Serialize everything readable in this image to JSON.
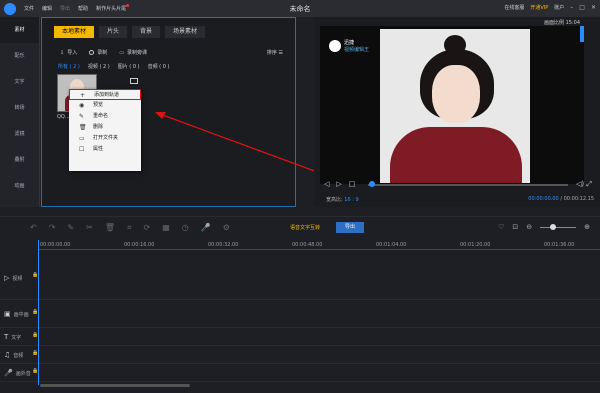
{
  "titlebar": {
    "menu": [
      "文件",
      "编辑",
      "导出",
      "帮助",
      "制作片头片尾"
    ],
    "title": "未命名",
    "online_service": "在线客服",
    "vip": "开通VIP",
    "account": "账户"
  },
  "sidebar": {
    "items": [
      "素材",
      "配乐",
      "文字",
      "转场",
      "滤镜",
      "叠附",
      "动画"
    ]
  },
  "media_panel": {
    "tabs": [
      "本地素材",
      "片头",
      "背景",
      "场景素材"
    ],
    "tools": {
      "import": "导入",
      "record": "录制",
      "record_mic": "录制旁课"
    },
    "sort": "排序",
    "filters": [
      "所有 ( 2 )",
      "视频 ( 2 )",
      "图片 ( 0 )",
      "音频 ( 0 )"
    ],
    "thumb_label": "QQ..."
  },
  "context_menu": {
    "items": [
      {
        "icon": "+",
        "label": "添加到轨道"
      },
      {
        "icon": "◉",
        "label": "预览"
      },
      {
        "icon": "✎",
        "label": "重命名"
      },
      {
        "icon": "🗑",
        "label": "删除"
      },
      {
        "icon": "▭",
        "label": "打开文件夹"
      },
      {
        "icon": "☐",
        "label": "属性"
      }
    ]
  },
  "preview": {
    "top_label": "画面比例 15:04",
    "watermark_small": "迅捷",
    "watermark": "视频编辑王",
    "ratio_label": "宽高比:",
    "ratio_value": "16 : 9",
    "time_current": "00:00:00.00",
    "time_total": "/ 00:00:12.15",
    "progress": 0
  },
  "timeline": {
    "ocr_label": "语音文字互转",
    "export_label": "导出",
    "ruler": [
      "00:00:00.00",
      "00:00:16.00",
      "00:00:32.00",
      "00:00:48.00",
      "00:01:04.00",
      "00:01:20.00",
      "00:01:36.00"
    ],
    "tracks": [
      {
        "icon": "▷",
        "label": "视频"
      },
      {
        "icon": "▣",
        "label": "画中画"
      },
      {
        "icon": "T",
        "label": "文字"
      },
      {
        "icon": "♫",
        "label": "音频"
      },
      {
        "icon": "🎤",
        "label": "画外音"
      }
    ]
  }
}
